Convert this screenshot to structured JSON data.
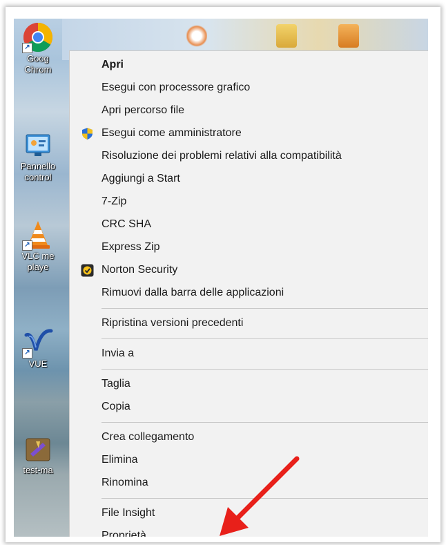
{
  "desktop": {
    "icons": [
      {
        "label": "Goog\nChrom"
      },
      {
        "label": "Pannello\ncontrol"
      },
      {
        "label": "VLC me\nplaye"
      },
      {
        "label": "VUE"
      },
      {
        "label": "test-ma"
      }
    ]
  },
  "menu": {
    "groups": [
      [
        {
          "label": "Apri",
          "bold": true
        },
        {
          "label": "Esegui con processore grafico",
          "submenu": true
        },
        {
          "label": "Apri percorso file"
        },
        {
          "label": "Esegui come amministratore",
          "icon": "uac-shield-icon"
        },
        {
          "label": "Risoluzione dei problemi relativi alla compatibilità"
        },
        {
          "label": "Aggiungi a Start"
        },
        {
          "label": "7-Zip",
          "submenu": true
        },
        {
          "label": "CRC SHA",
          "submenu": true
        },
        {
          "label": "Express Zip",
          "submenu": true
        },
        {
          "label": "Norton Security",
          "submenu": true,
          "icon": "norton-icon"
        },
        {
          "label": "Rimuovi dalla barra delle applicazioni"
        }
      ],
      [
        {
          "label": "Ripristina versioni precedenti"
        }
      ],
      [
        {
          "label": "Invia a",
          "submenu": true
        }
      ],
      [
        {
          "label": "Taglia"
        },
        {
          "label": "Copia"
        }
      ],
      [
        {
          "label": "Crea collegamento"
        },
        {
          "label": "Elimina"
        },
        {
          "label": "Rinomina"
        }
      ],
      [
        {
          "label": "File Insight"
        },
        {
          "label": "Proprietà"
        }
      ]
    ]
  },
  "annotation": {
    "arrow_color": "#e8201a",
    "points_to": "Proprietà"
  }
}
